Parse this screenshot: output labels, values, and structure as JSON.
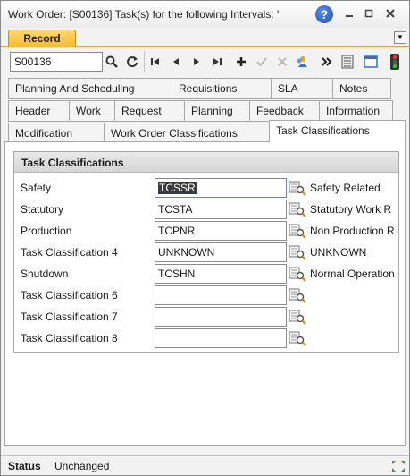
{
  "window": {
    "title": "Work Order: [S00136] Task(s) for the following Intervals: '"
  },
  "record_tab": {
    "label": "Record"
  },
  "toolbar": {
    "search_value": "S00136"
  },
  "tabs": {
    "row1": [
      {
        "label": "Planning And Scheduling"
      },
      {
        "label": "Requisitions"
      },
      {
        "label": "SLA"
      },
      {
        "label": "Notes"
      }
    ],
    "row2": [
      {
        "label": "Header"
      },
      {
        "label": "Work"
      },
      {
        "label": "Request"
      },
      {
        "label": "Planning"
      },
      {
        "label": "Feedback"
      },
      {
        "label": "Information"
      }
    ],
    "row3": [
      {
        "label": "Modification"
      },
      {
        "label": "Work Order Classifications"
      },
      {
        "label": "Task Classifications"
      }
    ]
  },
  "section": {
    "title": "Task Classifications",
    "fields": [
      {
        "label": "Safety",
        "value": "TCSSR",
        "description": "Safety Related"
      },
      {
        "label": "Statutory",
        "value": "TCSTA",
        "description": "Statutory Work R"
      },
      {
        "label": "Production",
        "value": "TCPNR",
        "description": "Non Production R"
      },
      {
        "label": "Task Classification 4",
        "value": "UNKNOWN",
        "description": "UNKNOWN"
      },
      {
        "label": "Shutdown",
        "value": "TCSHN",
        "description": "Normal Operation"
      },
      {
        "label": "Task Classification 6",
        "value": "",
        "description": ""
      },
      {
        "label": "Task Classification 7",
        "value": "",
        "description": ""
      },
      {
        "label": "Task Classification 8",
        "value": "",
        "description": ""
      }
    ]
  },
  "status": {
    "label": "Status",
    "value": "Unchanged"
  }
}
